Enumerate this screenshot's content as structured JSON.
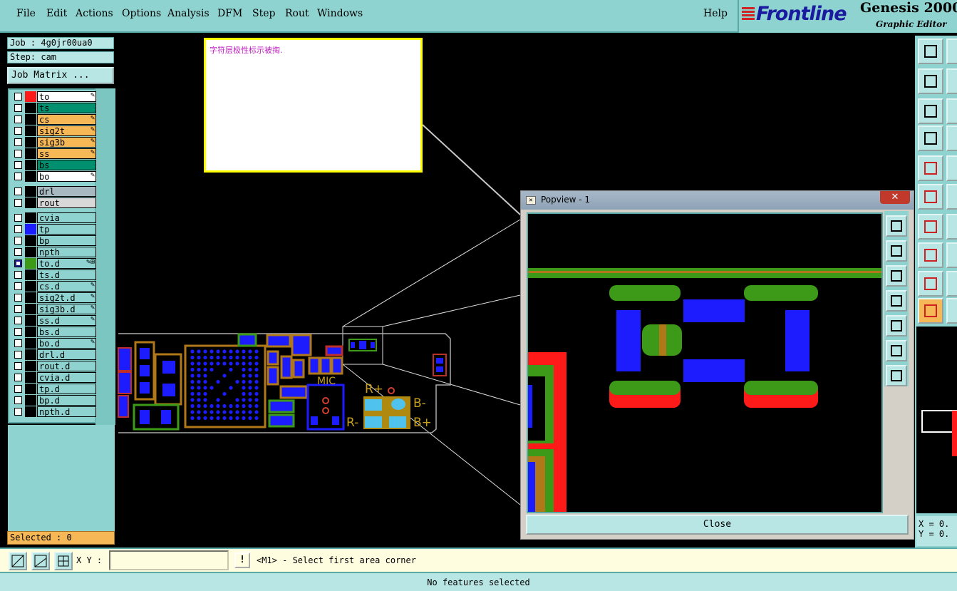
{
  "menu": [
    "File",
    "Edit",
    "Actions",
    "Options",
    "Analysis",
    "DFM",
    "Step",
    "Rout",
    "Windows"
  ],
  "help": "Help",
  "brand": {
    "logo": "Frontline",
    "title": "Genesis 2000",
    "subtitle": "Graphic Editor"
  },
  "job": {
    "job_line": "Job : 4g0jr00ua0",
    "step_line": "Step: cam",
    "matrix_button": "Job Matrix ..."
  },
  "layers": [
    {
      "name": "to",
      "color": "#ff1a1a",
      "bg": "#ffffff",
      "flag": "✎"
    },
    {
      "name": "ts",
      "color": "#000000",
      "bg": "#009070",
      "flag": ""
    },
    {
      "name": "cs",
      "color": "#000000",
      "bg": "#f6b756",
      "flag": "✎"
    },
    {
      "name": "sig2t",
      "color": "#000000",
      "bg": "#f6b756",
      "flag": "✎"
    },
    {
      "name": "sig3b",
      "color": "#000000",
      "bg": "#f6b756",
      "flag": "✎"
    },
    {
      "name": "ss",
      "color": "#000000",
      "bg": "#f6b756",
      "flag": "✎"
    },
    {
      "name": "bs",
      "color": "#000000",
      "bg": "#009070",
      "flag": ""
    },
    {
      "name": "bo",
      "color": "#000000",
      "bg": "#ffffff",
      "flag": "✎"
    },
    {
      "name": "drl",
      "color": "#000000",
      "bg": "#a8b8c0",
      "flag": ""
    },
    {
      "name": "rout",
      "color": "#000000",
      "bg": "#d8d8d8",
      "flag": ""
    },
    {
      "name": "cvia",
      "color": "#000000",
      "bg": "#8fd3d0",
      "flag": ""
    },
    {
      "name": "tp",
      "color": "#1c1cff",
      "bg": "#8fd3d0",
      "flag": ""
    },
    {
      "name": "bp",
      "color": "#000000",
      "bg": "#8fd3d0",
      "flag": ""
    },
    {
      "name": "npth",
      "color": "#000000",
      "bg": "#8fd3d0",
      "flag": ""
    },
    {
      "name": "to.d",
      "color": "#3c9a18",
      "bg": "#8fd3d0",
      "flag": "✎⊞"
    },
    {
      "name": "ts.d",
      "color": "#000000",
      "bg": "#8fd3d0",
      "flag": ""
    },
    {
      "name": "cs.d",
      "color": "#000000",
      "bg": "#8fd3d0",
      "flag": "✎"
    },
    {
      "name": "sig2t.d",
      "color": "#000000",
      "bg": "#8fd3d0",
      "flag": "✎"
    },
    {
      "name": "sig3b.d",
      "color": "#000000",
      "bg": "#8fd3d0",
      "flag": "✎"
    },
    {
      "name": "ss.d",
      "color": "#000000",
      "bg": "#8fd3d0",
      "flag": "✎"
    },
    {
      "name": "bs.d",
      "color": "#000000",
      "bg": "#8fd3d0",
      "flag": ""
    },
    {
      "name": "bo.d",
      "color": "#000000",
      "bg": "#8fd3d0",
      "flag": "✎"
    },
    {
      "name": "drl.d",
      "color": "#000000",
      "bg": "#8fd3d0",
      "flag": ""
    },
    {
      "name": "rout.d",
      "color": "#000000",
      "bg": "#8fd3d0",
      "flag": ""
    },
    {
      "name": "cvia.d",
      "color": "#000000",
      "bg": "#8fd3d0",
      "flag": ""
    },
    {
      "name": "tp.d",
      "color": "#000000",
      "bg": "#8fd3d0",
      "flag": ""
    },
    {
      "name": "bp.d",
      "color": "#000000",
      "bg": "#8fd3d0",
      "flag": ""
    },
    {
      "name": "npth.d",
      "color": "#000000",
      "bg": "#8fd3d0",
      "flag": ""
    }
  ],
  "selected": "Selected : 0",
  "note": "字符层极性标示被掏.",
  "board_labels": {
    "mic": "MIC",
    "r_plus": "R+",
    "r_minus": "R-",
    "b_minus": "B-",
    "b_plus": "B+"
  },
  "popview": {
    "title": "Popview - 1",
    "close_x": "✕",
    "close_button": "Close"
  },
  "coords": {
    "x": "X = 0.",
    "y": "Y = 0."
  },
  "cmdbar": {
    "xy_label": "X Y :",
    "xy_value": "",
    "bang": "!",
    "prompt": "<M1> - Select first area corner"
  },
  "status": "No features selected",
  "colors": {
    "panel": "#8fd3d0",
    "copper": "#3c9a18",
    "pad": "#1c1cff",
    "mask": "#ff1a1a",
    "silk": "#c8a020"
  }
}
